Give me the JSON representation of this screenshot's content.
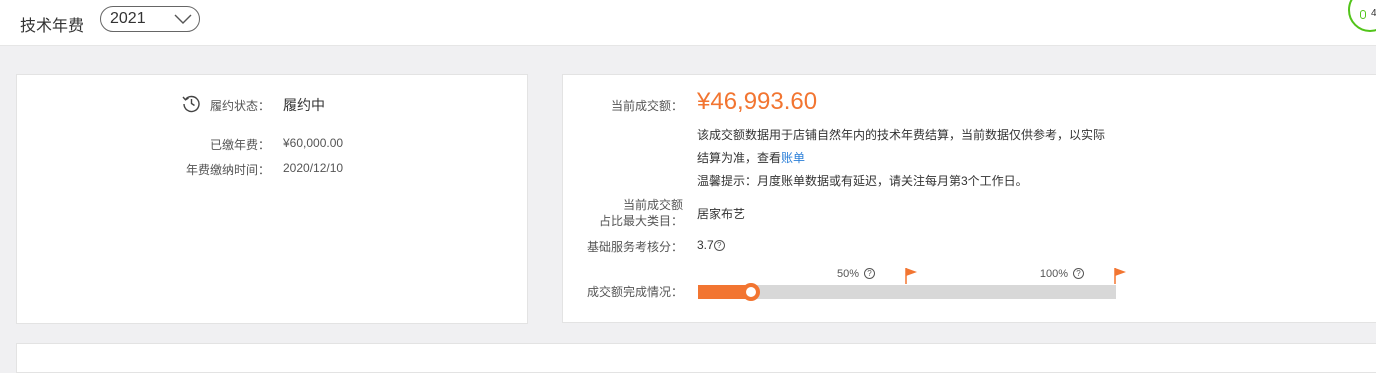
{
  "header": {
    "title": "技术年费",
    "year_selected": "2021",
    "corner_badge": "4"
  },
  "contract": {
    "status_label": "履约状态：",
    "status_value": "履约中",
    "paid_label": "已缴年费：",
    "paid_value": "¥60,000.00",
    "paid_time_label": "年费缴纳时间：",
    "paid_time_value": "2020/12/10"
  },
  "turnover": {
    "current_label": "当前成交额：",
    "current_value": "¥46,993.60",
    "desc_line1": "该成交额数据用于店铺自然年内的技术年费结算，当前数据仅供参考，以实际",
    "desc_line2_prefix": "结算为准，查看",
    "bill_link": "账单",
    "warm_tip": "温馨提示：月度账单数据或有延迟，请关注每月第3个工作日。",
    "category_label_line1": "当前成交额",
    "category_label_line2": "占比最大类目：",
    "category_value": "居家布艺",
    "score_label": "基础服务考核分：",
    "score_value": "3.7",
    "progress_label": "成交额完成情况：",
    "progress_fraction": 0.13,
    "milestones": [
      {
        "label": "50%",
        "fraction": 0.5
      },
      {
        "label": "100%",
        "fraction": 1.0
      }
    ],
    "accent_color": "#f27531"
  }
}
